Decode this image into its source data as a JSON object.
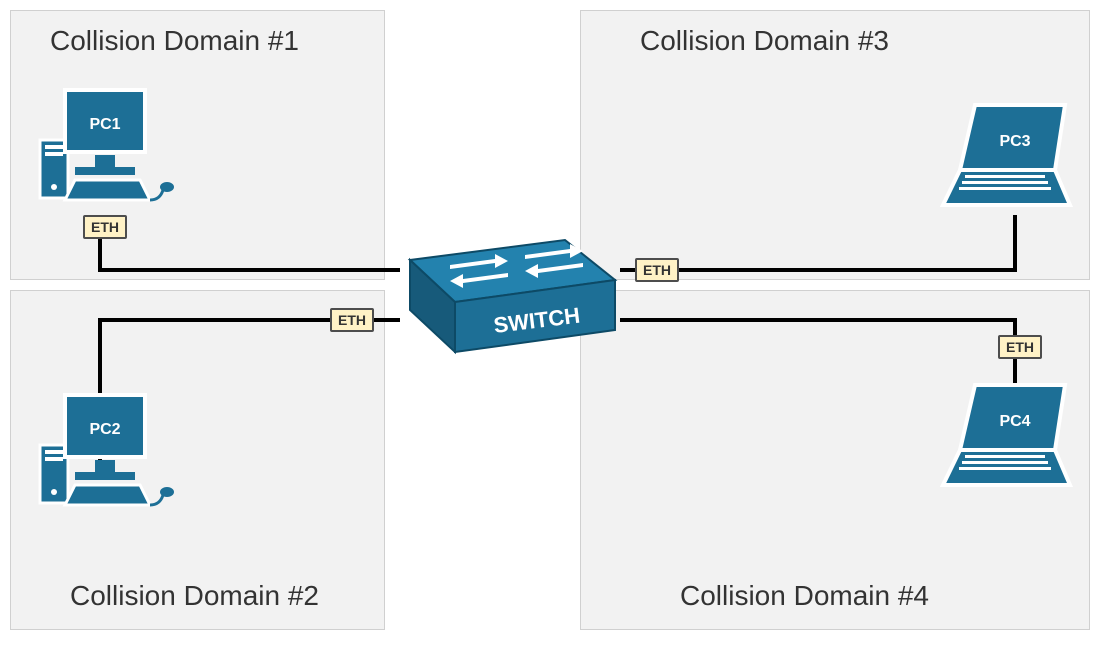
{
  "colors": {
    "primary": "#1d6f96",
    "primaryLight": "#2382ae",
    "primaryDark": "#175a7a",
    "domainBg": "#f2f2f2",
    "ethBg": "#fff2c6"
  },
  "switch": {
    "label": "SWITCH"
  },
  "ports": {
    "p1": "ETH",
    "p2": "ETH",
    "p3": "ETH",
    "p4": "ETH"
  },
  "domains": {
    "d1": {
      "title": "Collision Domain #1",
      "device": "PC1",
      "type": "desktop"
    },
    "d2": {
      "title": "Collision Domain #2",
      "device": "PC2",
      "type": "desktop"
    },
    "d3": {
      "title": "Collision Domain #3",
      "device": "PC3",
      "type": "laptop"
    },
    "d4": {
      "title": "Collision Domain #4",
      "device": "PC4",
      "type": "laptop"
    }
  }
}
